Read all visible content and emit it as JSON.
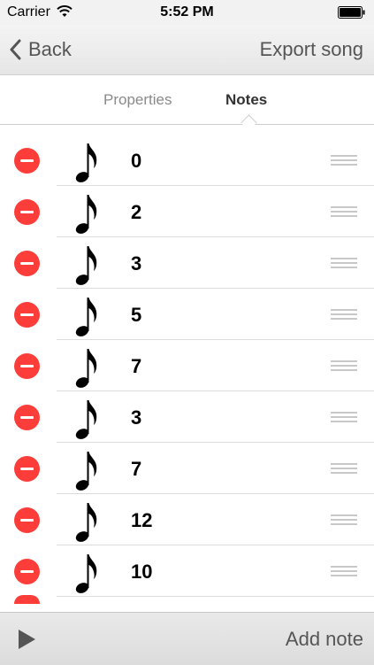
{
  "status_bar": {
    "carrier": "Carrier",
    "time": "5:52 PM",
    "wifi_icon": "wifi-icon",
    "battery_icon": "battery-icon"
  },
  "nav": {
    "back_label": "Back",
    "back_icon": "chevron-left-icon",
    "export_label": "Export song"
  },
  "tabs": [
    {
      "label": "Properties",
      "selected": false
    },
    {
      "label": "Notes",
      "selected": true
    }
  ],
  "notes": [
    {
      "value": "0"
    },
    {
      "value": "2"
    },
    {
      "value": "3"
    },
    {
      "value": "5"
    },
    {
      "value": "7"
    },
    {
      "value": "3"
    },
    {
      "value": "7"
    },
    {
      "value": "12"
    },
    {
      "value": "10"
    }
  ],
  "toolbar": {
    "play_icon": "play-icon",
    "add_note_label": "Add note"
  },
  "colors": {
    "delete": "#fc3d39",
    "nav_text": "#555555",
    "separator": "#dcdcdc"
  }
}
